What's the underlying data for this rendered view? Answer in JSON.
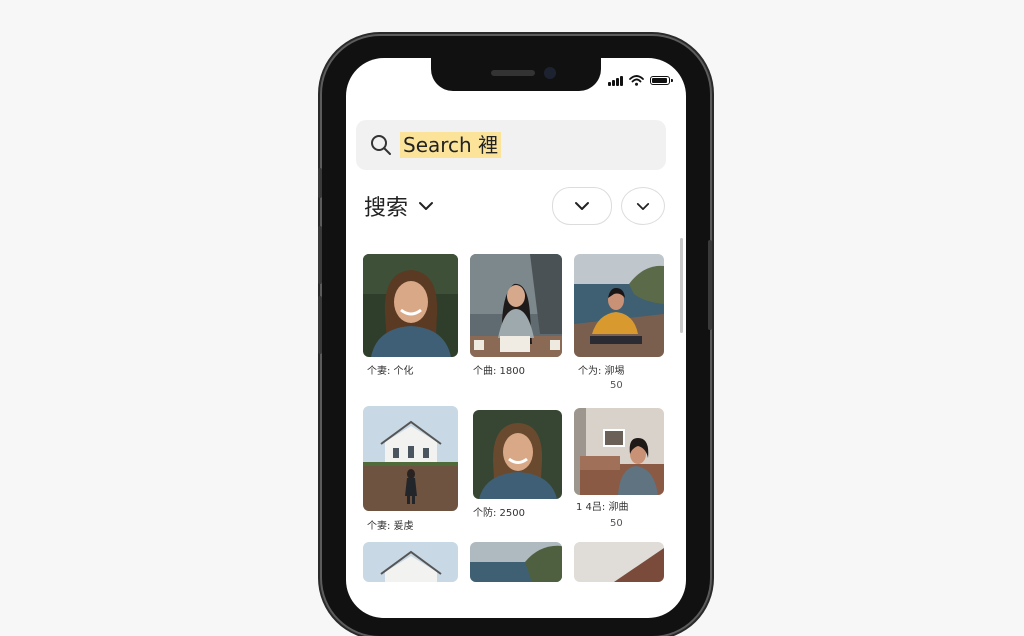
{
  "search": {
    "text": "Search 裡"
  },
  "filter": {
    "label": "搜索"
  },
  "grid": {
    "items": [
      {
        "caption": "个妻: 个化",
        "subcaption": ""
      },
      {
        "caption": "个曲: 1800",
        "subcaption": ""
      },
      {
        "caption": "个为: 泖埸",
        "subcaption": "50"
      },
      {
        "caption": "个妻: 爰虔",
        "subcaption": ""
      },
      {
        "caption": "个防: 2500",
        "subcaption": ""
      },
      {
        "caption": "1 4吕: 泖曲",
        "subcaption": "50"
      }
    ]
  },
  "colors": {
    "highlight": "#fbe39a",
    "search_bg": "#f1f1f1",
    "frame": "#111111"
  }
}
